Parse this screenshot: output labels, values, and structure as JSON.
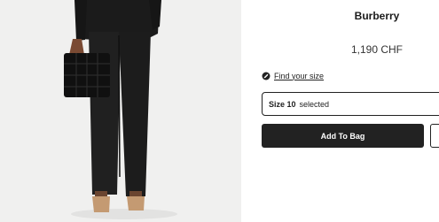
{
  "product": {
    "brand": "Burberry",
    "price": "1,190 CHF",
    "image_alt": "Model wearing black tailored trousers holding a black quilted clutch"
  },
  "size_guide": {
    "icon": "ruler-icon",
    "label": "Find your size"
  },
  "size_selector": {
    "size_label": "Size 10",
    "status": "selected"
  },
  "actions": {
    "add_to_bag_label": "Add To Bag",
    "wishlist_icon": "heart-icon"
  },
  "colors": {
    "primary_button": "#222222",
    "photo_background": "#f0f0ef"
  }
}
